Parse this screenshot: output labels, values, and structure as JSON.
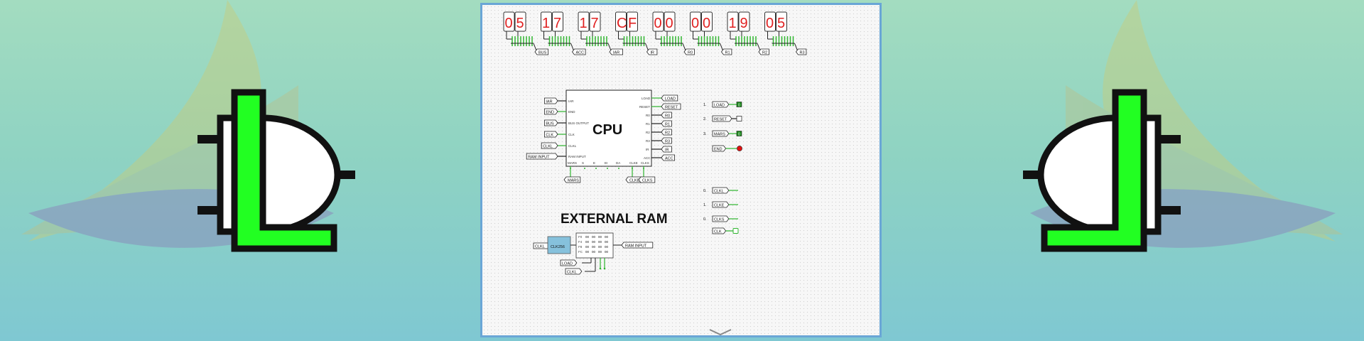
{
  "displays": [
    {
      "value": "05",
      "label": "BUS"
    },
    {
      "value": "17",
      "label": "ACC"
    },
    {
      "value": "17",
      "label": "IAR"
    },
    {
      "value": "CF",
      "label": "IR"
    },
    {
      "value": "00",
      "label": "R0"
    },
    {
      "value": "00",
      "label": "R1"
    },
    {
      "value": "19",
      "label": "R2"
    },
    {
      "value": "05",
      "label": "R3"
    }
  ],
  "cpu": {
    "title": "CPU",
    "left_pins": [
      "IAR",
      "END",
      "BUS OUTPUT",
      "CLK",
      "CLKL",
      "RAM INPUT"
    ],
    "right_pins": [
      "LOAD",
      "RESET",
      "R0",
      "R1",
      "R2",
      "R3",
      "IR",
      "ACC"
    ],
    "bottom_pins": [
      "MARS",
      "S",
      "E",
      "EI",
      "DA",
      "CLKE",
      "CLKS"
    ],
    "left_tunnels": [
      "IAR",
      "END",
      "BUS",
      "CLK",
      "CLKL",
      "RAM INPUT"
    ],
    "right_tunnels": [
      "LOAD",
      "RESET",
      "R0",
      "R1",
      "R2",
      "R3",
      "IR",
      "ACC"
    ],
    "bottom_tunnels": [
      "MARS",
      "CLKE",
      "CLKS"
    ]
  },
  "ram": {
    "title": "EXTERNAL RAM",
    "counter_label": "CLK256",
    "input_tunnel": "CLKL",
    "output_tunnel": "RAM INPUT",
    "bottom_tunnels": [
      "LOAD",
      "CLKL"
    ],
    "rows": [
      {
        "addr": "F0",
        "cells": [
          "00",
          "00",
          "00",
          "00"
        ]
      },
      {
        "addr": "F4",
        "cells": [
          "00",
          "00",
          "00",
          "00"
        ]
      },
      {
        "addr": "F8",
        "cells": [
          "00",
          "00",
          "00",
          "00"
        ]
      },
      {
        "addr": "FC",
        "cells": [
          "00",
          "00",
          "00",
          "00"
        ]
      }
    ]
  },
  "inputs": [
    {
      "index": "1.",
      "label": "LOAD",
      "state": "0"
    },
    {
      "index": "2.",
      "label": "RESET",
      "state": ""
    },
    {
      "index": "3.",
      "label": "MARS",
      "state": "0"
    },
    {
      "index": "",
      "label": "END",
      "state": ""
    }
  ],
  "clocks": [
    {
      "index": "0.",
      "label": "CLKL"
    },
    {
      "index": "1.",
      "label": "CLKE"
    },
    {
      "index": "0.",
      "label": "CLKS"
    },
    {
      "index": "",
      "label": "CLK"
    }
  ],
  "colors": {
    "active": "#2fb52f",
    "digit": "#e02020",
    "led_red": "#e01010",
    "logo_green": "#22ff22"
  },
  "icons": [
    "logic-gate-logo",
    "scroll-down-chevron"
  ]
}
